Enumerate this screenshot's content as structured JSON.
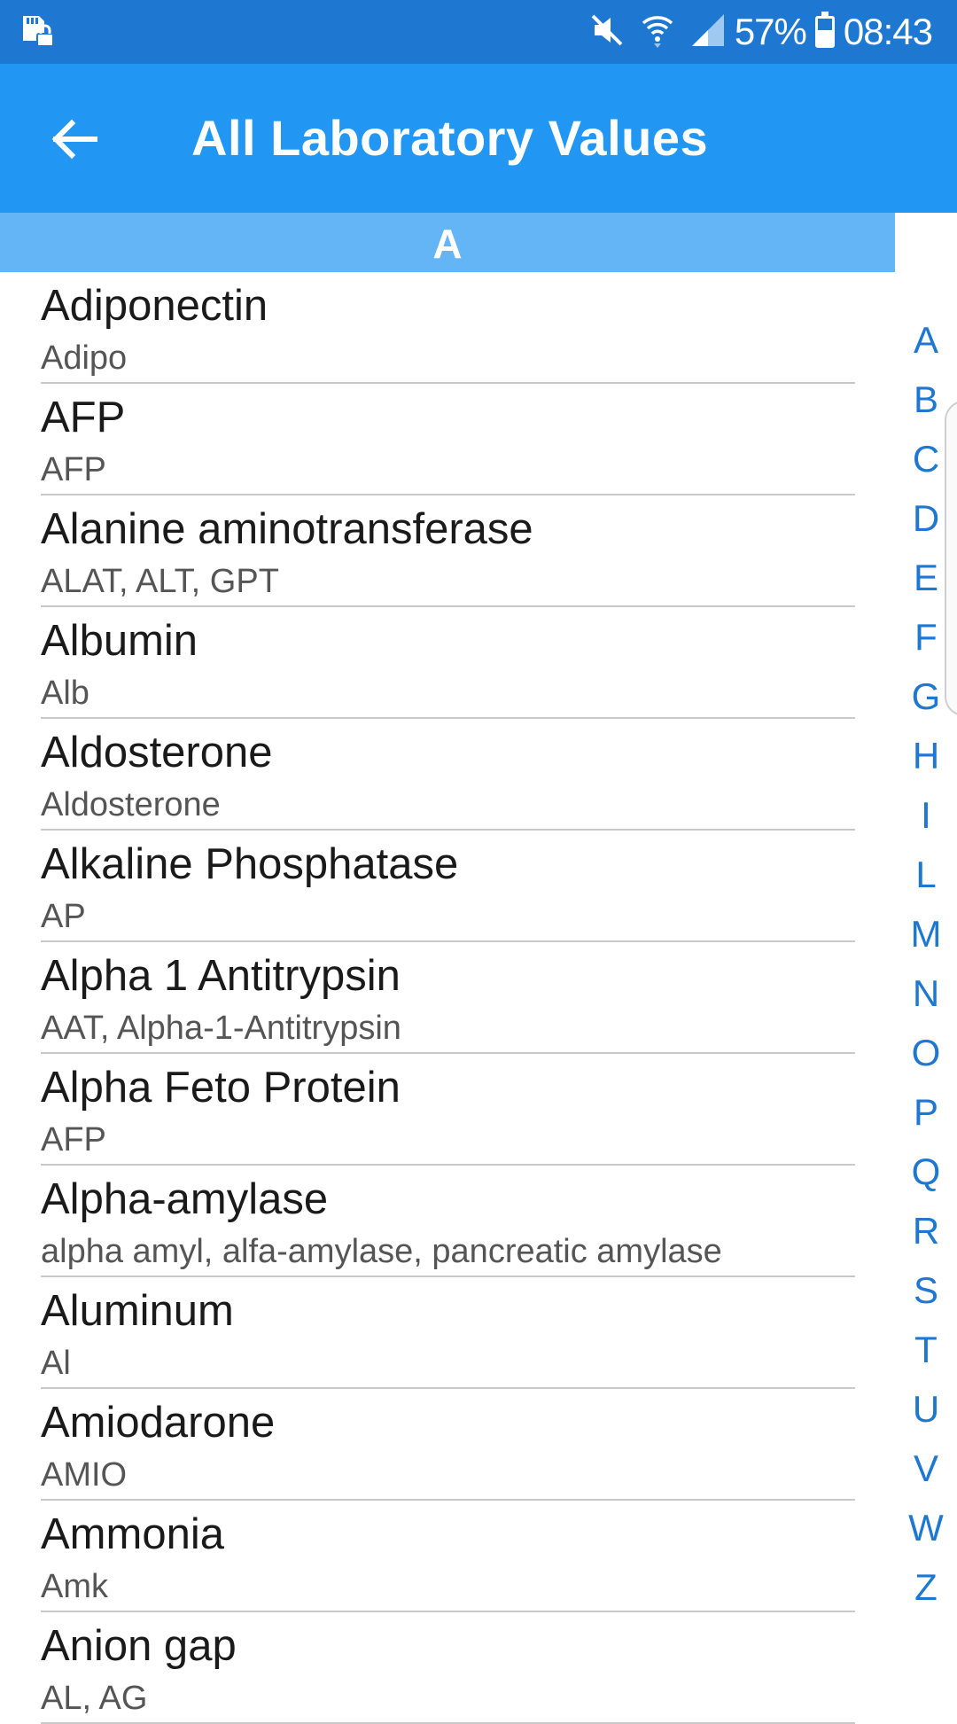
{
  "status_bar": {
    "battery_percent_label": "57%",
    "battery_level": 0.57,
    "time": "08:43",
    "icons": [
      "sd-card-lock-icon",
      "mute-icon",
      "wifi-icon",
      "signal-icon",
      "battery-icon"
    ]
  },
  "app_bar": {
    "title": "All Laboratory Values",
    "back_icon": "arrow-left-icon"
  },
  "section": {
    "header": "A"
  },
  "items": [
    {
      "name": "Adiponectin",
      "abbr": "Adipo"
    },
    {
      "name": "AFP",
      "abbr": "AFP"
    },
    {
      "name": "Alanine aminotransferase",
      "abbr": "ALAT, ALT, GPT"
    },
    {
      "name": "Albumin",
      "abbr": "Alb"
    },
    {
      "name": "Aldosterone",
      "abbr": "Aldosterone"
    },
    {
      "name": "Alkaline Phosphatase",
      "abbr": "AP"
    },
    {
      "name": "Alpha 1 Antitrypsin",
      "abbr": "AAT, Alpha-1-Antitrypsin"
    },
    {
      "name": "Alpha Feto Protein",
      "abbr": "AFP"
    },
    {
      "name": "Alpha-amylase",
      "abbr": "alpha amyl, alfa-amylase, pancreatic amylase"
    },
    {
      "name": "Aluminum",
      "abbr": "Al"
    },
    {
      "name": "Amiodarone",
      "abbr": "AMIO"
    },
    {
      "name": "Ammonia",
      "abbr": "Amk"
    },
    {
      "name": "Anion gap",
      "abbr": "AL, AG"
    }
  ],
  "alphabet_index": [
    "A",
    "B",
    "C",
    "D",
    "E",
    "F",
    "G",
    "H",
    "I",
    "L",
    "M",
    "N",
    "O",
    "P",
    "Q",
    "R",
    "S",
    "T",
    "U",
    "V",
    "W",
    "Z"
  ]
}
